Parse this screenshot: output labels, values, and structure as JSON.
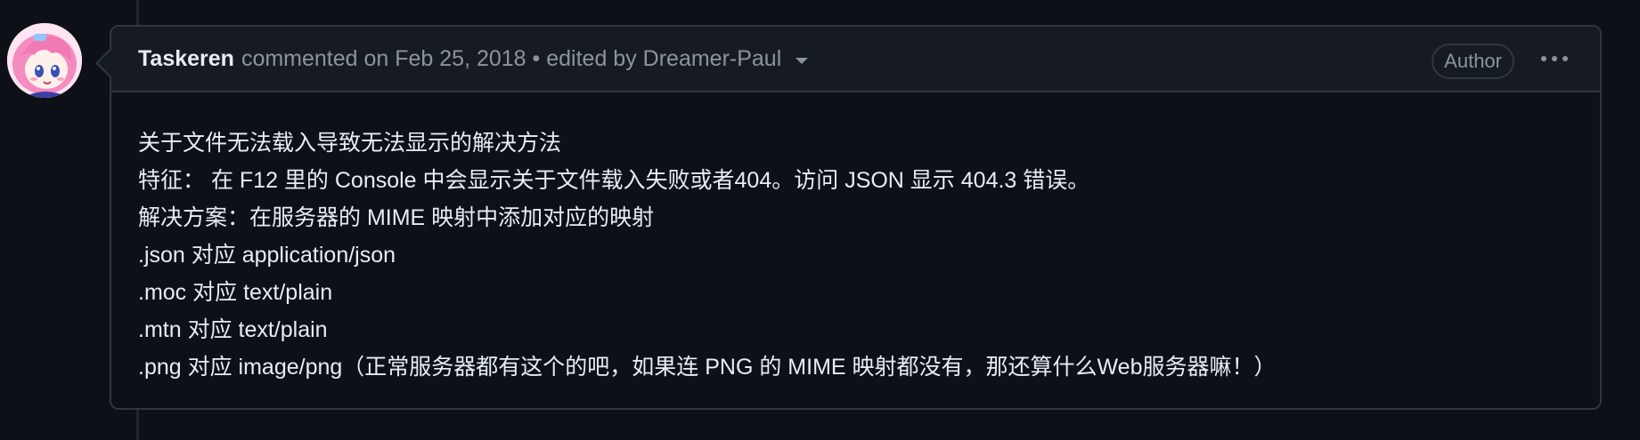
{
  "comment": {
    "author": "Taskeren",
    "commented": "commented on Feb 25, 2018",
    "separator": " • ",
    "edited_by": "edited by Dreamer-Paul",
    "badge": "Author",
    "lines": [
      "关于文件无法载入导致无法显示的解决方法",
      "特征： 在 F12 里的 Console 中会显示关于文件载入失败或者404。访问 JSON 显示 404.3 错误。",
      "解决方案：在服务器的 MIME 映射中添加对应的映射",
      ".json 对应 application/json",
      ".moc 对应 text/plain",
      ".mtn 对应 text/plain",
      ".png 对应 image/png（正常服务器都有这个的吧，如果连 PNG 的 MIME 映射都没有，那还算什么Web服务器嘛！）"
    ]
  },
  "icons": {
    "avatar": "anime-avatar",
    "menu": "kebab-horizontal-icon",
    "caret": "triangle-down-icon"
  },
  "colors": {
    "background": "#0d1117",
    "header_bg": "#161b22",
    "border": "#30363d",
    "text": "#e6edf3",
    "muted": "#8b949e"
  }
}
